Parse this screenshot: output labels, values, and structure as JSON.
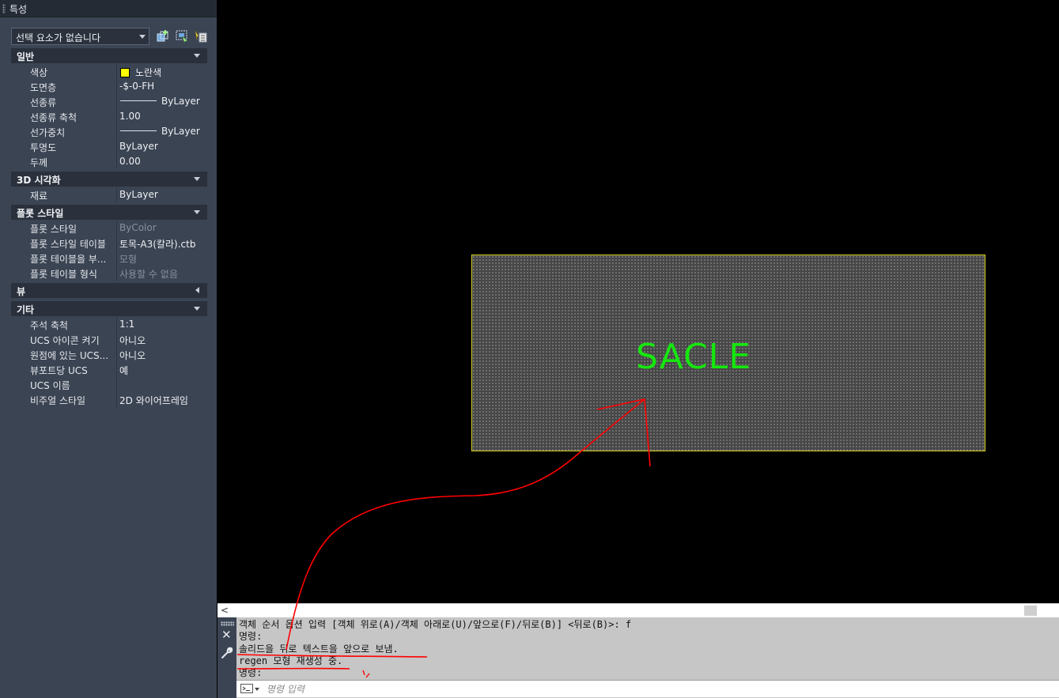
{
  "palette": {
    "title": "특성",
    "selection": "선택 요소가 없습니다",
    "toolbar_icons": [
      "pickadd-icon",
      "select-objects-icon",
      "quick-select-icon"
    ],
    "sections": [
      {
        "label": "일반",
        "expanded": true,
        "rows": [
          {
            "name": "색상",
            "value": "노란색",
            "swatch": "#ffff00"
          },
          {
            "name": "도면층",
            "value": "-$-0-FH"
          },
          {
            "name": "선종류",
            "value": "ByLayer",
            "linetype": true
          },
          {
            "name": "선종류 축척",
            "value": "1.00"
          },
          {
            "name": "선가중치",
            "value": "ByLayer",
            "linetype": true
          },
          {
            "name": "투명도",
            "value": "ByLayer"
          },
          {
            "name": "두께",
            "value": "0.00"
          }
        ]
      },
      {
        "label": "3D 시각화",
        "expanded": true,
        "rows": [
          {
            "name": "재료",
            "value": "ByLayer"
          }
        ]
      },
      {
        "label": "플롯 스타일",
        "expanded": true,
        "rows": [
          {
            "name": "플롯 스타일",
            "value": "ByColor",
            "disabled": true
          },
          {
            "name": "플롯 스타일 테이블",
            "value": "토목-A3(칼라).ctb"
          },
          {
            "name": "플롯 테이블을 부...",
            "value": "모형",
            "disabled": true
          },
          {
            "name": "플롯 테이블 형식",
            "value": "사용할 수 없음",
            "disabled": true
          }
        ]
      },
      {
        "label": "뷰",
        "expanded": false,
        "rows": []
      },
      {
        "label": "기타",
        "expanded": true,
        "rows": [
          {
            "name": "주석 축척",
            "value": "1:1"
          },
          {
            "name": "UCS 아이콘 켜기",
            "value": "아니오"
          },
          {
            "name": "원점에 있는 UCS...",
            "value": "아니오"
          },
          {
            "name": "뷰포트당 UCS",
            "value": "예"
          },
          {
            "name": "UCS 이름",
            "value": ""
          },
          {
            "name": "비주얼 스타일",
            "value": "2D 와이어프레임"
          }
        ]
      }
    ]
  },
  "drawing": {
    "hatch_text": "SACLE",
    "text_color": "#16e60e",
    "boundary_color": "#d9d320",
    "annotation_color": "#ff0000"
  },
  "scrollbar": {
    "left_arrow": "<"
  },
  "command_line": {
    "history": [
      "객체 순서 옵션 입력 [객체 위로(A)/객체 아래로(U)/앞으로(F)/뒤로(B)] <뒤로(B)>: f",
      "명령:",
      "솔리드을 뒤로 텍스트을 앞으로 보냄.",
      "regen 모형 재생성 중.",
      "명령:"
    ],
    "close_glyph": "✕",
    "input_placeholder": "명령 입력"
  }
}
